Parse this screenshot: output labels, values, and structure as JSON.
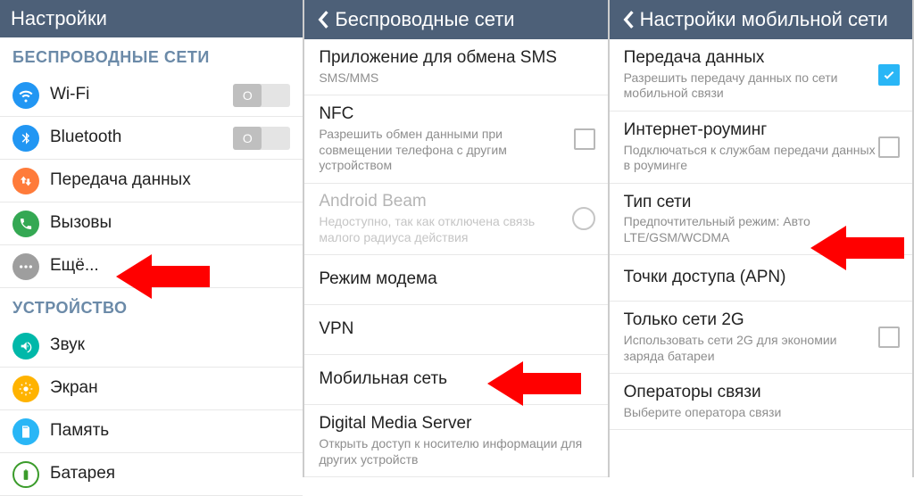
{
  "panel1": {
    "title": "Настройки",
    "section_wireless": "БЕСПРОВОДНЫЕ СЕТИ",
    "wifi": "Wi-Fi",
    "bluetooth": "Bluetooth",
    "data": "Передача данных",
    "calls": "Вызовы",
    "more": "Ещё...",
    "section_device": "УСТРОЙСТВО",
    "sound": "Звук",
    "display": "Экран",
    "storage": "Память",
    "battery": "Батарея",
    "toggle_off": "O"
  },
  "panel2": {
    "title": "Беспроводные сети",
    "sms_title": "Приложение для обмена SMS",
    "sms_sub": "SMS/MMS",
    "nfc_title": "NFC",
    "nfc_sub": "Разрешить обмен данными при совмещении телефона с другим устройством",
    "beam_title": "Android Beam",
    "beam_sub": "Недоступно, так как отключена связь малого радиуса действия",
    "tether": "Режим модема",
    "vpn": "VPN",
    "mobile": "Мобильная сеть",
    "dms_title": "Digital Media Server",
    "dms_sub": "Открыть доступ к носителю информации для других устройств"
  },
  "panel3": {
    "title": "Настройки мобильной сети",
    "data_title": "Передача данных",
    "data_sub": "Разрешить передачу данных по сети мобильной связи",
    "roam_title": "Интернет-роуминг",
    "roam_sub": "Подключаться к службам передачи данных в роуминге",
    "nettype_title": "Тип сети",
    "nettype_sub": "Предпочтительный режим: Авто LTE/GSM/WCDMA",
    "apn": "Точки доступа (APN)",
    "only2g_title": "Только сети 2G",
    "only2g_sub": "Использовать сети 2G для экономии заряда батареи",
    "ops_title": "Операторы связи",
    "ops_sub": "Выберите оператора связи"
  }
}
